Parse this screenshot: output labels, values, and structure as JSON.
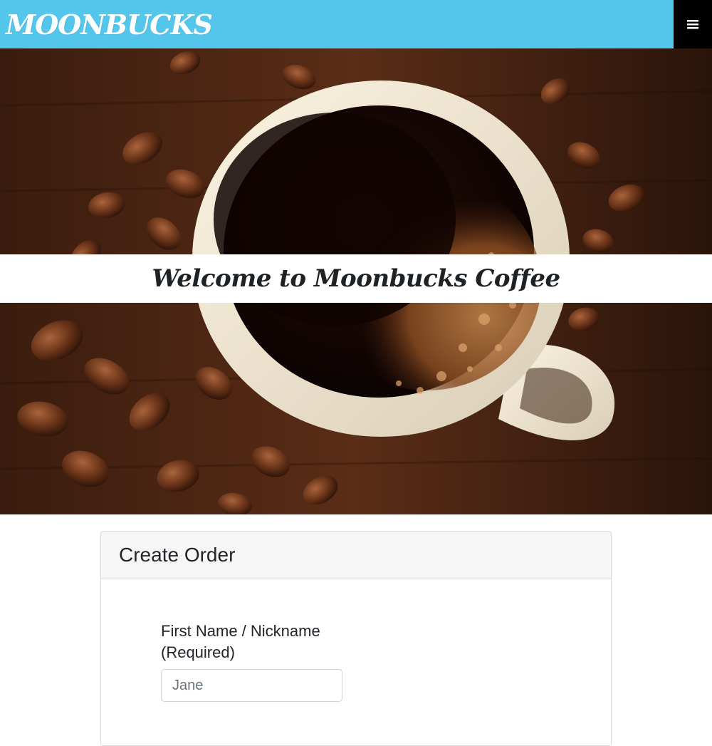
{
  "navbar": {
    "brand": "MOONBUCKS",
    "menu_icon": "hamburger-menu-icon",
    "background_color": "#54c6ec"
  },
  "hero": {
    "welcome": "Welcome to Moonbucks Coffee",
    "image": "coffee-cup-with-beans"
  },
  "order_card": {
    "title": "Create Order",
    "first_name_label": "First Name / Nickname (Required)",
    "first_name_placeholder": "Jane"
  }
}
